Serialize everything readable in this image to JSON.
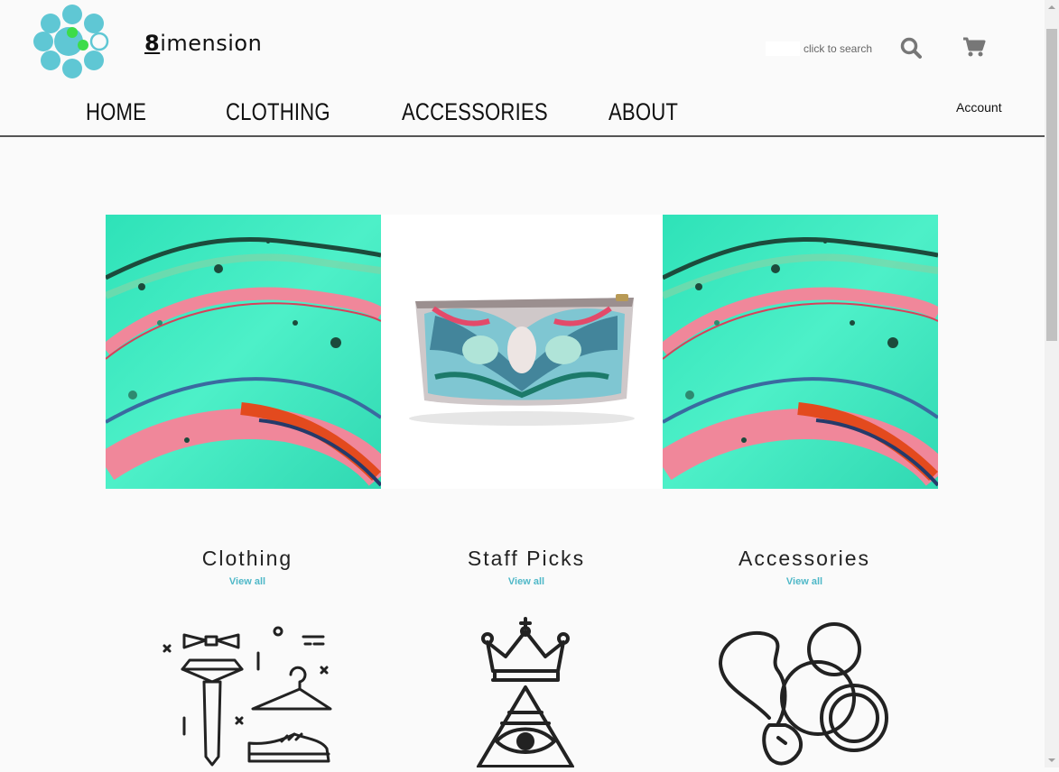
{
  "header": {
    "logo_text_main": "imension",
    "logo_text_eight": "8",
    "search_placeholder": "click to search",
    "account_label": "Account"
  },
  "nav": {
    "items": [
      "HOME",
      "CLOTHING",
      "ACCESSORIES",
      "ABOUT"
    ]
  },
  "categories": [
    {
      "title": "Clothing",
      "link": "View all"
    },
    {
      "title": "Staff Picks",
      "link": "View all"
    },
    {
      "title": "Accessories",
      "link": "View all"
    }
  ],
  "colors": {
    "accent": "#4fb8c8",
    "logo_circle": "#5fc7d4",
    "logo_green": "#3ddc4a",
    "hero_teal": "#3fe8c0",
    "hero_pink": "#f08a98",
    "hero_red": "#e34a1e"
  },
  "icons": [
    "search-icon",
    "cart-icon"
  ]
}
